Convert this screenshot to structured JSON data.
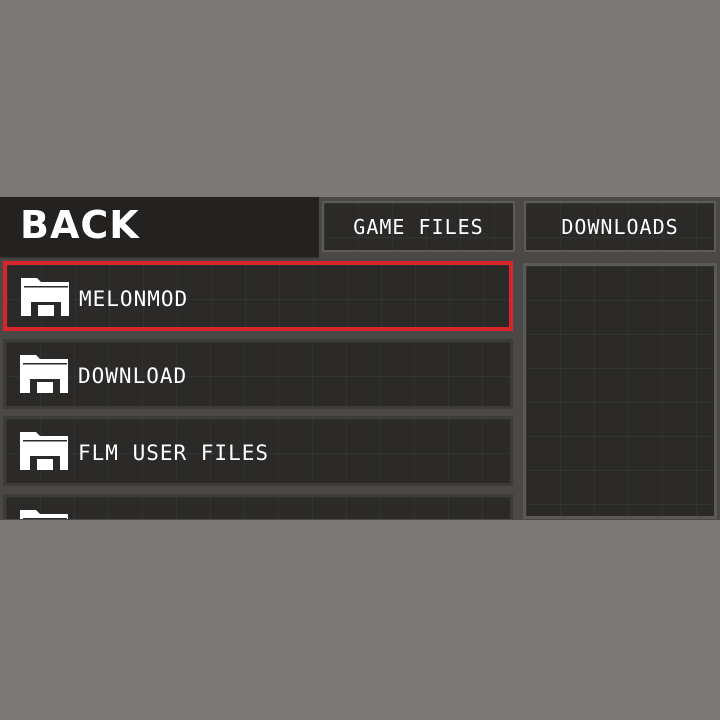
{
  "nav": {
    "back_label": "BACK",
    "game_files_label": "GAME FILES",
    "downloads_label": "DOWNLOADS"
  },
  "file_list": {
    "items": [
      {
        "label": "MELONMOD",
        "icon": "folder-icon",
        "selected": true
      },
      {
        "label": "DOWNLOAD",
        "icon": "folder-icon",
        "selected": false
      },
      {
        "label": "FLM USER FILES",
        "icon": "folder-icon",
        "selected": false
      },
      {
        "label": "",
        "icon": "folder-icon",
        "selected": false
      }
    ]
  },
  "colors": {
    "background": "#7b7875",
    "panel": "#2b2a29",
    "selection_border": "#d8242b",
    "text": "#ffffff"
  }
}
